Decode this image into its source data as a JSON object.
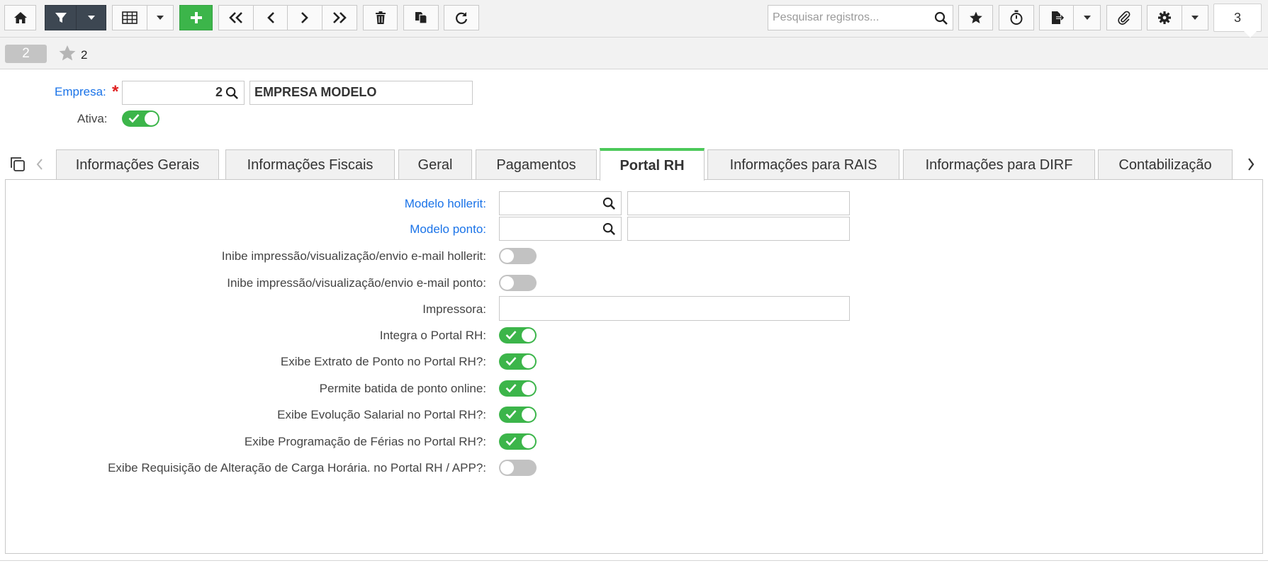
{
  "toolbar": {
    "search_placeholder": "Pesquisar registros...",
    "record_counter": "3"
  },
  "record_bar": {
    "badge": "2",
    "favorite_count": "2"
  },
  "header_form": {
    "empresa_label": "Empresa:",
    "required_mark": "*",
    "empresa_code": "2",
    "empresa_name": "EMPRESA MODELO",
    "ativa_label": "Ativa:",
    "ativa_on": true
  },
  "tabs": [
    {
      "label": "Informações Gerais"
    },
    {
      "label": "Informações Fiscais"
    },
    {
      "label": "Geral"
    },
    {
      "label": "Pagamentos"
    },
    {
      "label": "Portal RH",
      "active": true
    },
    {
      "label": "Informações para RAIS"
    },
    {
      "label": "Informações para DIRF"
    },
    {
      "label": "Contabilização"
    }
  ],
  "form": {
    "modelo_hollerit_label": "Modelo hollerit:",
    "modelo_ponto_label": "Modelo ponto:",
    "impressora_label": "Impressora:",
    "toggles": [
      {
        "label": "Inibe impressão/visualização/envio e-mail hollerit:",
        "on": false
      },
      {
        "label": "Inibe impressão/visualização/envio e-mail ponto:",
        "on": false
      },
      {
        "label": "Integra o Portal RH:",
        "on": true
      },
      {
        "label": "Exibe Extrato de Ponto no Portal RH?:",
        "on": true
      },
      {
        "label": "Permite batida de ponto online:",
        "on": true
      },
      {
        "label": "Exibe Evolução Salarial no Portal RH?:",
        "on": true
      },
      {
        "label": "Exibe Programação de Férias no Portal RH?:",
        "on": true
      },
      {
        "label": "Exibe Requisição de Alteração de Carga Horária. no Portal RH / APP?:",
        "on": false
      }
    ]
  },
  "colors": {
    "accent_green": "#3cb54a",
    "link_blue": "#1a73e8",
    "dark_button": "#3d4752",
    "required_red": "#e02020"
  }
}
